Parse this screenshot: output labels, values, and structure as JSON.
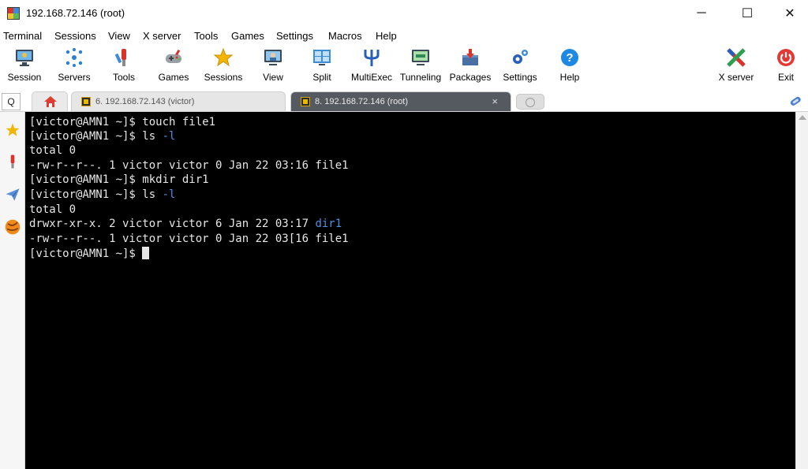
{
  "window": {
    "title": "192.168.72.146 (root)",
    "minimize_glyph": "─",
    "maximize_glyph": "☐",
    "close_glyph": "✕"
  },
  "menu": [
    "Terminal",
    "Sessions",
    "View",
    "X server",
    "Tools",
    "Games",
    "Settings",
    "Macros",
    "Help"
  ],
  "toolbar": [
    {
      "label": "Session",
      "icon": "monitor-session-icon"
    },
    {
      "label": "Servers",
      "icon": "servers-icon"
    },
    {
      "label": "Tools",
      "icon": "tools-icon"
    },
    {
      "label": "Games",
      "icon": "gamepad-icon"
    },
    {
      "label": "Sessions",
      "icon": "star-icon"
    },
    {
      "label": "View",
      "icon": "view-icon"
    },
    {
      "label": "Split",
      "icon": "split-icon"
    },
    {
      "label": "MultiExec",
      "icon": "multiexec-icon"
    },
    {
      "label": "Tunneling",
      "icon": "tunneling-icon"
    },
    {
      "label": "Packages",
      "icon": "packages-icon"
    },
    {
      "label": "Settings",
      "icon": "settings-icon"
    },
    {
      "label": "Help",
      "icon": "help-icon"
    },
    {
      "label": "X server",
      "icon": "x-server-icon"
    },
    {
      "label": "Exit",
      "icon": "power-icon"
    }
  ],
  "tabs": {
    "search_glyph": "Q",
    "items": [
      {
        "label": "6. 192.168.72.143 (victor)",
        "active": false
      },
      {
        "label": "8. 192.168.72.146 (root)",
        "active": true,
        "close_glyph": "×"
      }
    ]
  },
  "terminal": {
    "prompt": "[victor@AMN1 ~]$ ",
    "lines": [
      {
        "text": "[victor@AMN1 ~]$ touch file1"
      },
      {
        "text": "[victor@AMN1 ~]$ ls ",
        "highlight": "-l"
      },
      {
        "text": "total 0"
      },
      {
        "text": "-rw-r--r--. 1 victor victor 0 Jan 22 03:16 file1"
      },
      {
        "text": "[victor@AMN1 ~]$ mkdir dir1"
      },
      {
        "text": "[victor@AMN1 ~]$ ls ",
        "highlight": "-l"
      },
      {
        "text": "total 0"
      },
      {
        "text": "drwxr-xr-x. 2 victor victor 6 Jan 22 03:17 ",
        "highlight": "dir1"
      },
      {
        "text": "-rw-r--r--. 1 victor victor 0 Jan 22 03[16 file1"
      }
    ]
  },
  "colors": {
    "terminal_bg": "#000000",
    "terminal_fg": "#e6e6e6",
    "dir_color": "#4f8fe0",
    "active_tab": "#555a60"
  }
}
